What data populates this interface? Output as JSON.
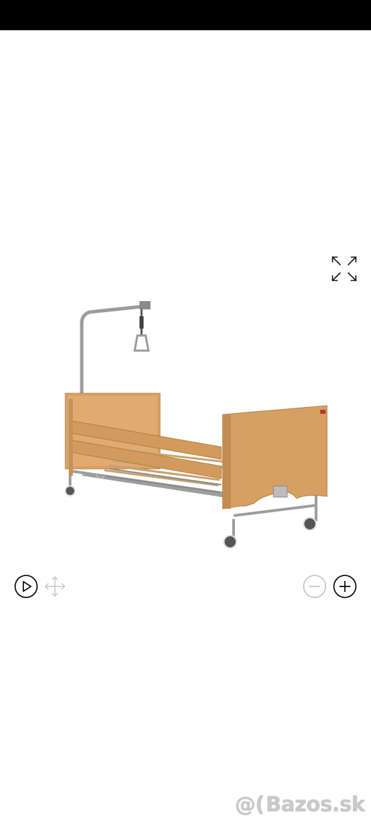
{
  "gallery": {
    "fullscreen_icon": "expand-arrows-icon",
    "controls": {
      "play_icon": "play-circle-icon",
      "pan_icon": "move-arrows-icon",
      "zoom_out_icon": "minus-circle-icon",
      "zoom_in_icon": "plus-circle-icon"
    },
    "watermark": {
      "prefix": "@(",
      "text": "Bazos.sk"
    }
  },
  "colors": {
    "wood": "#d9a468",
    "frame": "#a8a8a8",
    "icon": "#111111",
    "icon_disabled": "#c8c8c8",
    "watermark": "#c9c9c9"
  }
}
